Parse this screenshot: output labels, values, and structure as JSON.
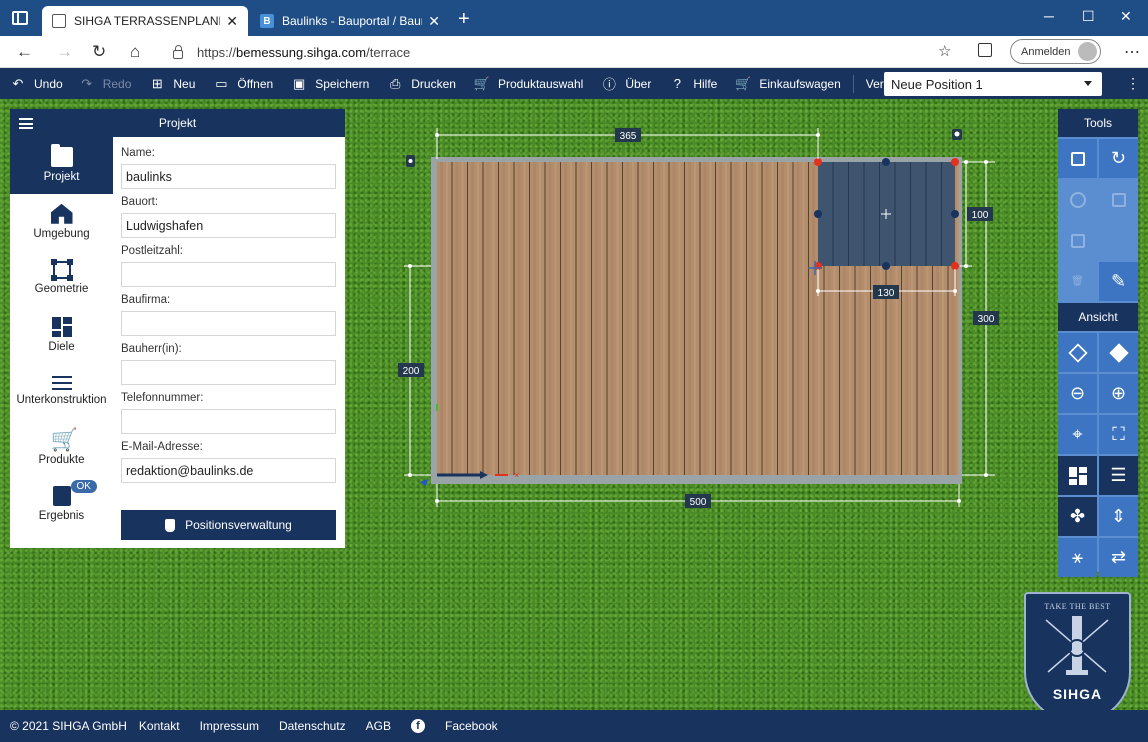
{
  "browser": {
    "tabs": [
      {
        "title": "SIHGA TERRASSENPLANER",
        "active": true
      },
      {
        "title": "Baulinks - Bauportal / Baumagaz",
        "active": false,
        "favicon": "B"
      }
    ],
    "url_prefix": "https://",
    "url_host": "bemessung.sihga.com",
    "url_path": "/terrace",
    "signin_label": "Anmelden"
  },
  "toolbar": {
    "items": [
      {
        "label": "Undo",
        "icon": "undo-icon",
        "enabled": true
      },
      {
        "label": "Redo",
        "icon": "redo-icon",
        "enabled": false
      },
      {
        "label": "Neu",
        "icon": "new-icon",
        "enabled": true
      },
      {
        "label": "Öffnen",
        "icon": "folder-open-icon",
        "enabled": true
      },
      {
        "label": "Speichern",
        "icon": "save-icon",
        "enabled": true
      },
      {
        "label": "Drucken",
        "icon": "print-icon",
        "enabled": true
      },
      {
        "label": "Produktauswahl",
        "icon": "cart-icon",
        "enabled": true
      },
      {
        "label": "Über",
        "icon": "info-icon",
        "enabled": true
      },
      {
        "label": "Hilfe",
        "icon": "help-icon",
        "enabled": true
      },
      {
        "label": "Einkaufswagen",
        "icon": "cart-add-icon",
        "enabled": true
      },
      {
        "label": "Verlegung",
        "icon": "",
        "enabled": true
      }
    ],
    "position_select": "Neue Position 1"
  },
  "panel": {
    "title": "Projekt",
    "nav": [
      {
        "label": "Projekt",
        "icon": "folder-icon",
        "active": true
      },
      {
        "label": "Umgebung",
        "icon": "home-icon",
        "active": false
      },
      {
        "label": "Geometrie",
        "icon": "geometry-icon",
        "active": false
      },
      {
        "label": "Diele",
        "icon": "diele-icon",
        "active": false
      },
      {
        "label": "Unterkonstruktion",
        "icon": "bars-icon",
        "active": false
      },
      {
        "label": "Produkte",
        "icon": "cart-icon",
        "active": false
      },
      {
        "label": "Ergebnis",
        "icon": "document-icon",
        "active": false,
        "badge": "OK"
      }
    ],
    "fields": [
      {
        "label": "Name:",
        "value": "baulinks"
      },
      {
        "label": "Bauort:",
        "value": "Ludwigshafen"
      },
      {
        "label": "Postleitzahl:",
        "value": ""
      },
      {
        "label": "Baufirma:",
        "value": ""
      },
      {
        "label": "Bauherr(in):",
        "value": ""
      },
      {
        "label": "Telefonnummer:",
        "value": ""
      },
      {
        "label": "E-Mail-Adresse:",
        "value": "redaktion@baulinks.de"
      }
    ],
    "button_label": "Positionsverwaltung"
  },
  "tools": {
    "header": "Tools",
    "view_header": "Ansicht"
  },
  "canvas": {
    "dimensions": {
      "top": "365",
      "bottom": "500",
      "left": "200",
      "right_outer": "300",
      "right_inner": "100",
      "cutout_width": "130"
    }
  },
  "logo": {
    "slogan": "TAKE THE BEST",
    "name": "SIHGA"
  },
  "footer": {
    "copyright": "© 2021 SIHGA GmbH",
    "links": [
      "Kontakt",
      "Impressum",
      "Datenschutz",
      "AGB"
    ],
    "facebook": "Facebook"
  },
  "colors": {
    "primary": "#17335e",
    "tool_blue": "#3d75c3",
    "grass": "#4a8a27",
    "deck_wood": "#b08a6a",
    "cutout": "#3e5574",
    "handle_red": "#e0321e"
  }
}
